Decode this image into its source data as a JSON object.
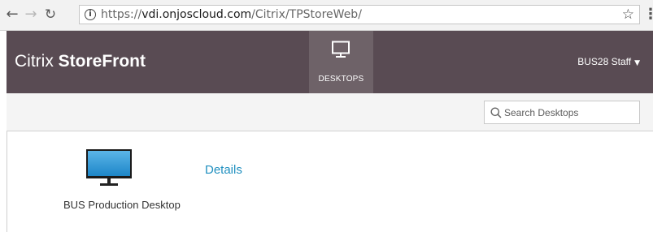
{
  "browser": {
    "back_icon": "←",
    "forward_icon": "→",
    "reload_icon": "↻",
    "info_icon": "i",
    "url_scheme": "https://",
    "url_host": "vdi.onjoscloud.com",
    "url_path": "/Citrix/TPStoreWeb/",
    "bookmark_icon": "☆",
    "menu_icon": "⋮"
  },
  "header": {
    "brand_light": "Citrix ",
    "brand_bold": "StoreFront",
    "tab_label": "DESKTOPS",
    "user_name": "BUS28 Staff",
    "user_caret": "▼",
    "colors": {
      "header_bg": "#594b53",
      "active_tab_bg": "#6e6268"
    }
  },
  "toolbar": {
    "search_placeholder": "Search Desktops"
  },
  "desktops": [
    {
      "name": "BUS Production Desktop",
      "details_label": "Details"
    }
  ],
  "icons": {
    "tab": "monitor-icon",
    "search": "search-icon",
    "desktop": "desktop-monitor-icon"
  },
  "colors": {
    "link": "#1f8fbf"
  }
}
